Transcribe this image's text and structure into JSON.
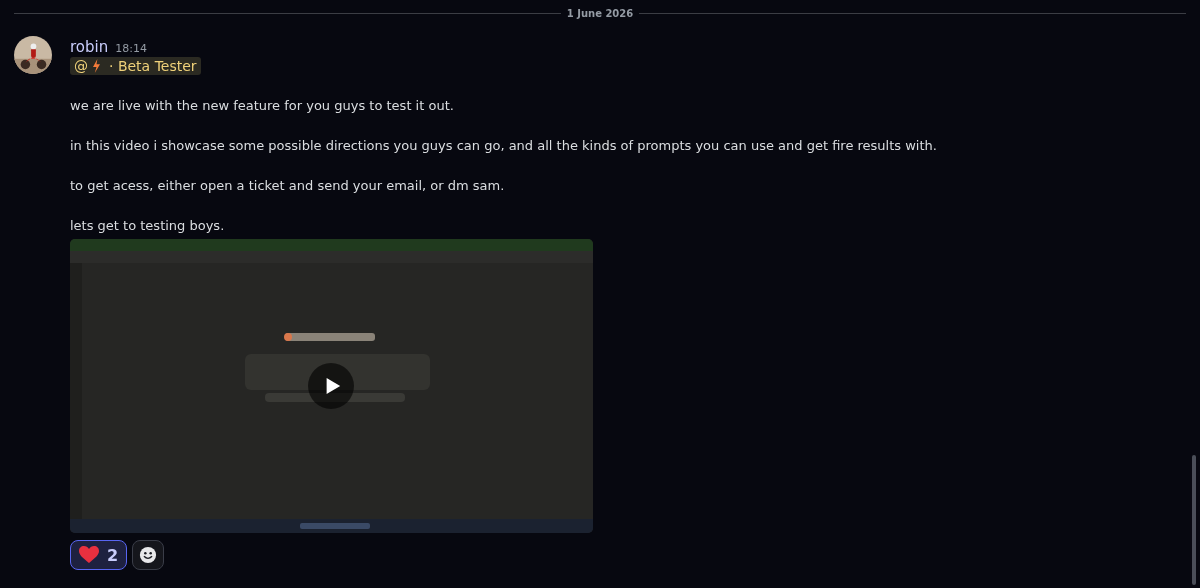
{
  "divider": {
    "date": "1 June 2026"
  },
  "message": {
    "author": "robin",
    "time": "18:14",
    "mention": {
      "at": "@",
      "label": "· Beta Tester"
    },
    "paragraphs": [
      "we are live with the new feature for you guys to test it out.",
      "in this video i showcase some possible directions you guys can go, and all the kinds of prompts you can use and get fire results with.",
      "to get acess, either open a ticket and send your email, or dm sam.",
      "lets get to testing boys."
    ],
    "reactions": [
      {
        "kind": "heart",
        "count": "2",
        "selected": true
      }
    ]
  }
}
